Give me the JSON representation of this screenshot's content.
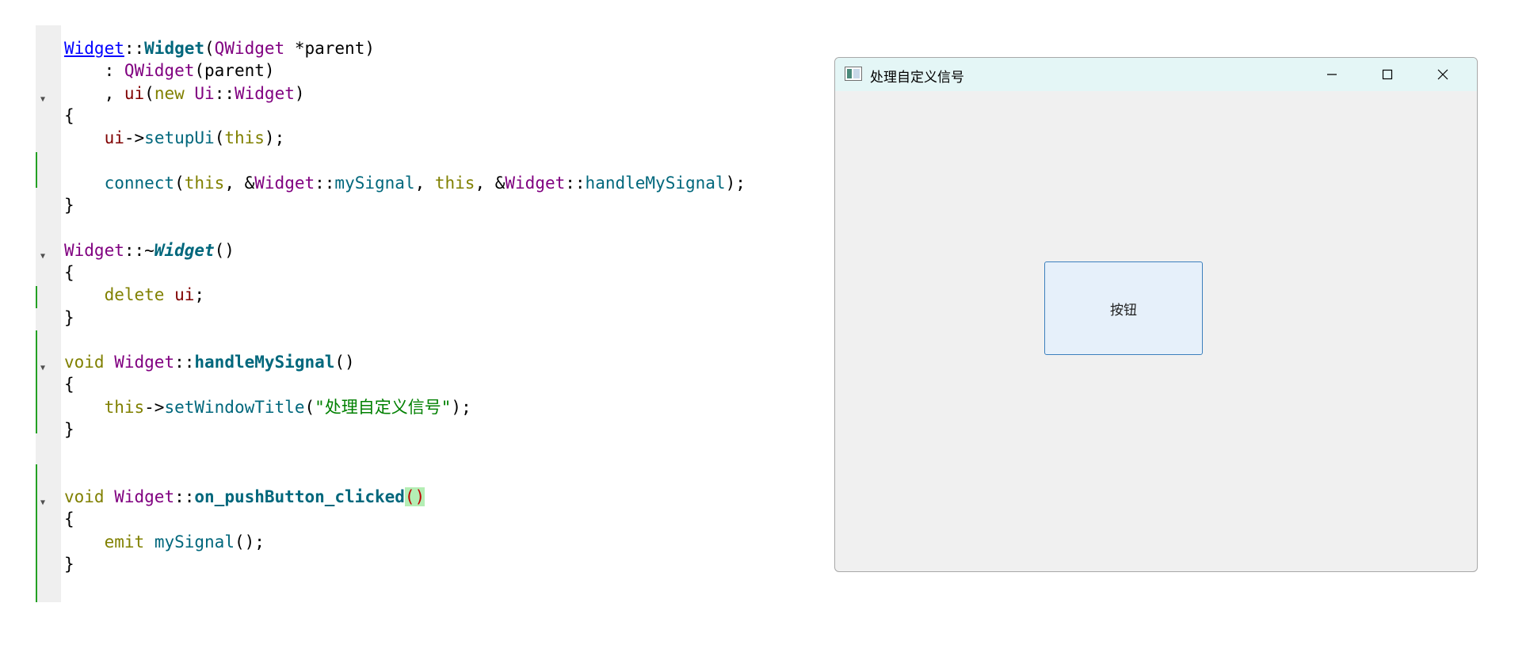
{
  "editor": {
    "lines": [
      [
        {
          "c": "t-type-u",
          "t": "Widget"
        },
        {
          "c": "",
          "t": "::"
        },
        {
          "c": "t-ctor",
          "t": "Widget"
        },
        {
          "c": "",
          "t": "("
        },
        {
          "c": "t-type",
          "t": "QWidget"
        },
        {
          "c": "",
          "t": " *parent)"
        }
      ],
      [
        {
          "c": "",
          "t": "    : "
        },
        {
          "c": "t-type",
          "t": "QWidget"
        },
        {
          "c": "",
          "t": "(parent)"
        }
      ],
      [
        {
          "c": "",
          "t": "    , "
        },
        {
          "c": "t-mem",
          "t": "ui"
        },
        {
          "c": "",
          "t": "("
        },
        {
          "c": "t-kw",
          "t": "new"
        },
        {
          "c": "",
          "t": " "
        },
        {
          "c": "t-type",
          "t": "Ui"
        },
        {
          "c": "",
          "t": "::"
        },
        {
          "c": "t-type",
          "t": "Widget"
        },
        {
          "c": "",
          "t": ")"
        }
      ],
      [
        {
          "c": "",
          "t": "{"
        }
      ],
      [
        {
          "c": "",
          "t": "    "
        },
        {
          "c": "t-mem",
          "t": "ui"
        },
        {
          "c": "",
          "t": "->"
        },
        {
          "c": "t-func",
          "t": "setupUi"
        },
        {
          "c": "",
          "t": "("
        },
        {
          "c": "t-kw",
          "t": "this"
        },
        {
          "c": "",
          "t": ");"
        }
      ],
      [],
      [
        {
          "c": "",
          "t": "    "
        },
        {
          "c": "t-func",
          "t": "connect"
        },
        {
          "c": "",
          "t": "("
        },
        {
          "c": "t-kw",
          "t": "this"
        },
        {
          "c": "",
          "t": ", &"
        },
        {
          "c": "t-type",
          "t": "Widget"
        },
        {
          "c": "",
          "t": "::"
        },
        {
          "c": "t-func",
          "t": "mySignal"
        },
        {
          "c": "",
          "t": ", "
        },
        {
          "c": "t-kw",
          "t": "this"
        },
        {
          "c": "",
          "t": ", &"
        },
        {
          "c": "t-type",
          "t": "Widget"
        },
        {
          "c": "",
          "t": "::"
        },
        {
          "c": "t-func",
          "t": "handleMySignal"
        },
        {
          "c": "",
          "t": ");"
        }
      ],
      [
        {
          "c": "",
          "t": "}"
        }
      ],
      [],
      [
        {
          "c": "t-type",
          "t": "Widget"
        },
        {
          "c": "",
          "t": "::~"
        },
        {
          "c": "t-dtor",
          "t": "Widget"
        },
        {
          "c": "",
          "t": "()"
        }
      ],
      [
        {
          "c": "",
          "t": "{"
        }
      ],
      [
        {
          "c": "",
          "t": "    "
        },
        {
          "c": "t-kw",
          "t": "delete"
        },
        {
          "c": "",
          "t": " "
        },
        {
          "c": "t-mem",
          "t": "ui"
        },
        {
          "c": "",
          "t": ";"
        }
      ],
      [
        {
          "c": "",
          "t": "}"
        }
      ],
      [],
      [
        {
          "c": "t-kw",
          "t": "void"
        },
        {
          "c": "",
          "t": " "
        },
        {
          "c": "t-type",
          "t": "Widget"
        },
        {
          "c": "",
          "t": "::"
        },
        {
          "c": "t-ctor",
          "t": "handleMySignal"
        },
        {
          "c": "",
          "t": "()"
        }
      ],
      [
        {
          "c": "",
          "t": "{"
        }
      ],
      [
        {
          "c": "",
          "t": "    "
        },
        {
          "c": "t-kw",
          "t": "this"
        },
        {
          "c": "",
          "t": "->"
        },
        {
          "c": "t-func",
          "t": "setWindowTitle"
        },
        {
          "c": "",
          "t": "("
        },
        {
          "c": "t-str",
          "t": "\"处理自定义信号\""
        },
        {
          "c": "",
          "t": ");"
        }
      ],
      [
        {
          "c": "",
          "t": "}"
        }
      ],
      [],
      [],
      [
        {
          "c": "t-kw",
          "t": "void"
        },
        {
          "c": "",
          "t": " "
        },
        {
          "c": "t-type",
          "t": "Widget"
        },
        {
          "c": "",
          "t": "::"
        },
        {
          "c": "t-ctor",
          "t": "on_pushButton_clicked"
        },
        {
          "c": "t-paren-match",
          "t": "()"
        }
      ],
      [
        {
          "c": "",
          "t": "{"
        }
      ],
      [
        {
          "c": "",
          "t": "    "
        },
        {
          "c": "t-kw",
          "t": "emit"
        },
        {
          "c": "",
          "t": " "
        },
        {
          "c": "t-func",
          "t": "mySignal"
        },
        {
          "c": "",
          "t": "();"
        }
      ],
      [
        {
          "c": "",
          "t": "}"
        }
      ]
    ],
    "fold_markers": [
      2,
      9,
      14,
      20
    ],
    "colors": {
      "gutter": "#efefef",
      "change_bar": "#23a023",
      "type": "#800080",
      "function": "#00677c",
      "keyword": "#808000",
      "member": "#800000",
      "string": "#008000"
    }
  },
  "window": {
    "title": "处理自定义信号",
    "button_label": "按钮",
    "icons": {
      "app": "app-window-icon",
      "minimize": "minimize-icon",
      "maximize": "maximize-icon",
      "close": "close-icon"
    },
    "colors": {
      "title_bar": "#e4f6f6",
      "client": "#f0f0f0",
      "button_bg": "#e6f0fa",
      "button_border": "#3c80bd"
    }
  }
}
